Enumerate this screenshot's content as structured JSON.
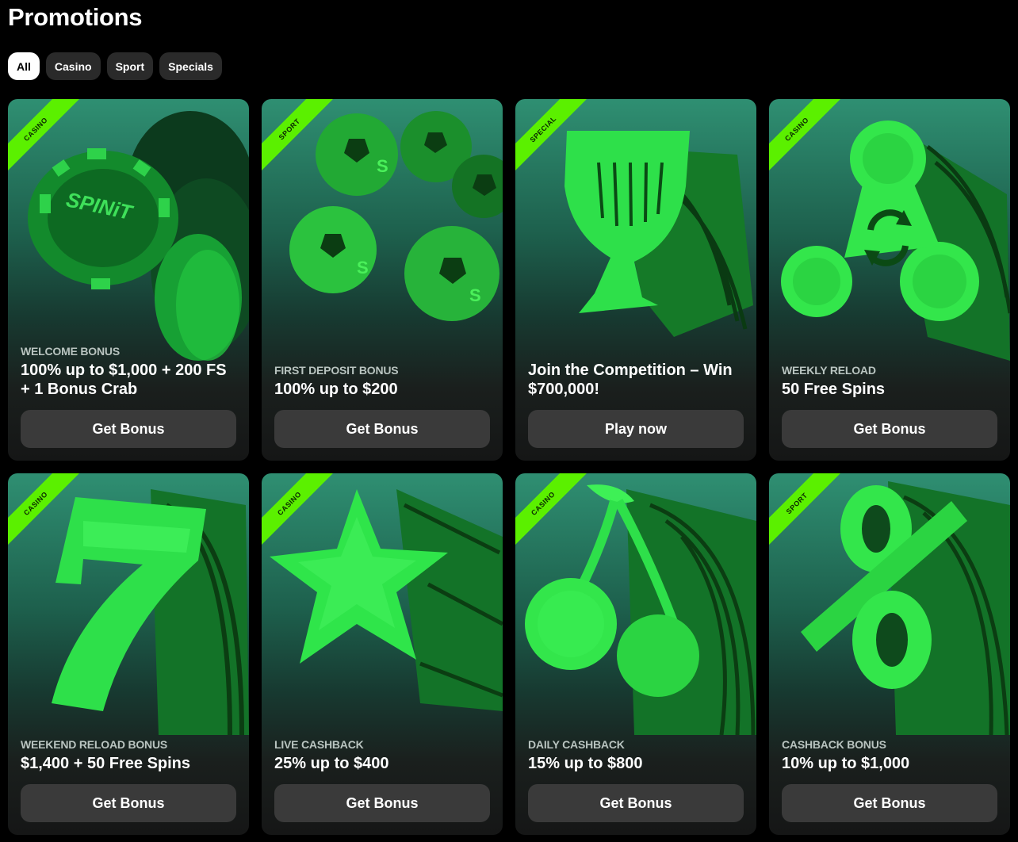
{
  "page": {
    "title": "Promotions"
  },
  "filters": [
    {
      "label": "All",
      "active": true
    },
    {
      "label": "Casino",
      "active": false
    },
    {
      "label": "Sport",
      "active": false
    },
    {
      "label": "Specials",
      "active": false
    }
  ],
  "colors": {
    "accent": "#5bf000",
    "background": "#000000",
    "button": "#3a3a3a"
  },
  "cards": [
    {
      "ribbon": "CASINO",
      "label": "WELCOME BONUS",
      "headline": "100% up to $1,000 + 200 FS + 1 Bonus Crab",
      "button": "Get Bonus",
      "art": "casino-chips-icon",
      "art_text": "SPINiT"
    },
    {
      "ribbon": "SPORT",
      "label": "FIRST DEPOSIT BONUS",
      "headline": "100% up to $200",
      "button": "Get Bonus",
      "art": "soccer-balls-icon"
    },
    {
      "ribbon": "SPECIAL",
      "label": "",
      "headline": "Join the Competition – Win $700,000!",
      "button": "Play now",
      "art": "trophy-icon"
    },
    {
      "ribbon": "CASINO",
      "label": "WEEKLY RELOAD",
      "headline": "50 Free Spins",
      "button": "Get Bonus",
      "art": "fidget-spinner-icon"
    },
    {
      "ribbon": "CASINO",
      "label": "WEEKEND RELOAD BONUS",
      "headline": "$1,400 + 50 Free Spins",
      "button": "Get Bonus",
      "art": "lucky-seven-icon"
    },
    {
      "ribbon": "CASINO",
      "label": "LIVE CASHBACK",
      "headline": "25% up to $400",
      "button": "Get Bonus",
      "art": "star-icon"
    },
    {
      "ribbon": "CASINO",
      "label": "DAILY CASHBACK",
      "headline": "15% up to $800",
      "button": "Get Bonus",
      "art": "cherries-icon"
    },
    {
      "ribbon": "SPORT",
      "label": "CASHBACK BONUS",
      "headline": "10% up to $1,000",
      "button": "Get Bonus",
      "art": "percent-icon"
    }
  ]
}
